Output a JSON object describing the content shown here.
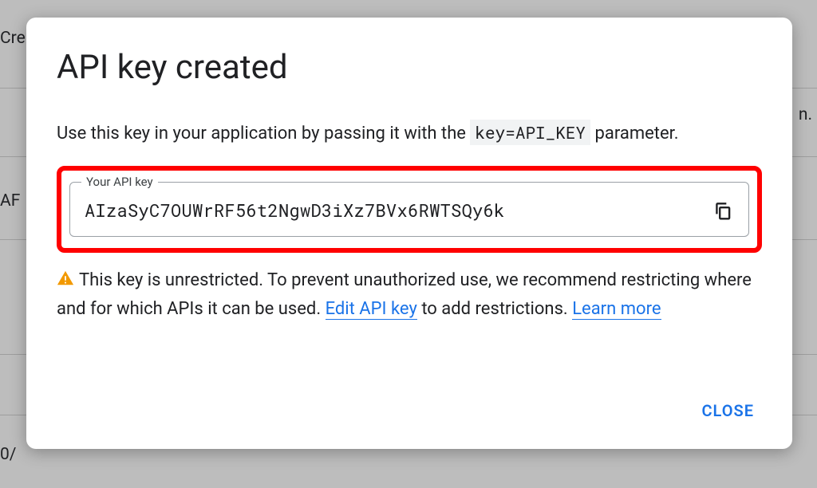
{
  "background": {
    "t1": "Cre",
    "t2": "n.",
    "t3": "AF",
    "t4": "0/"
  },
  "dialog": {
    "title": "API key created",
    "description_prefix": "Use this key in your application by passing it with the ",
    "description_code": "key=API_KEY",
    "description_suffix": " parameter.",
    "api_key_label": "Your API key",
    "api_key_value": "AIzaSyC7OUWrRF56t2NgwD3iXz7BVx6RWTSQy6k",
    "warning_text1": "This key is unrestricted. To prevent unauthorized use, we recommend restricting where and for which APIs it can be used. ",
    "edit_link": "Edit API key",
    "warning_text2": " to add restrictions. ",
    "learn_link": "Learn more",
    "close_label": "CLOSE"
  }
}
